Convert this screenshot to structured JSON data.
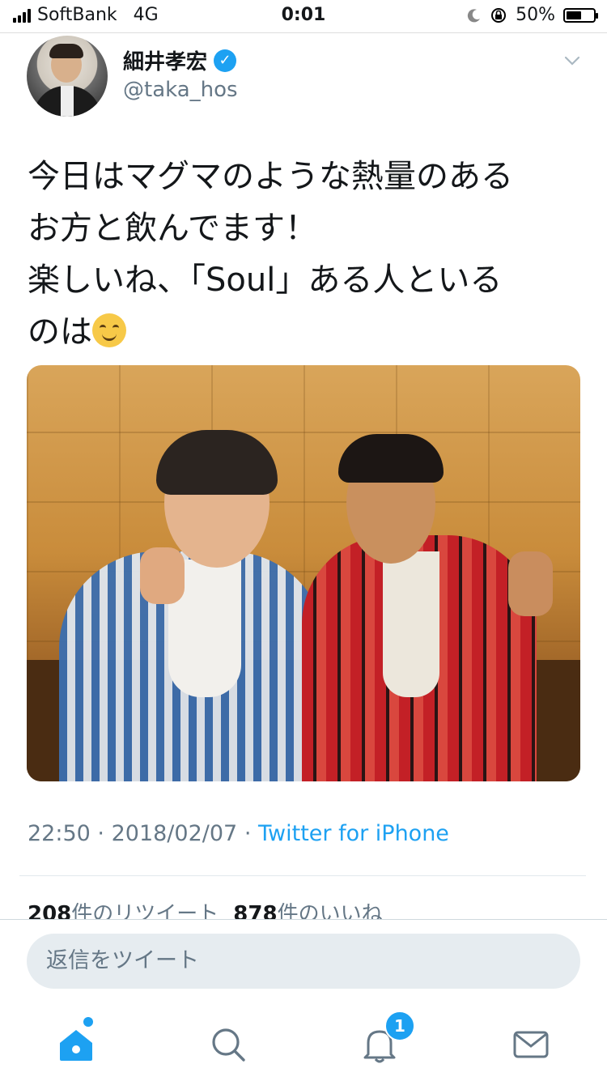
{
  "status_bar": {
    "carrier": "SoftBank",
    "network": "4G",
    "time": "0:01",
    "battery": "50%"
  },
  "tweet": {
    "author_name": "細井孝宏",
    "handle": "@taka_hos",
    "text": "今日はマグマのような熱量のある\nお方と飲んでます！\n楽しいね、「Soul」ある人といる\nのは",
    "emoji": "smiling-face-icon",
    "time": "22:50",
    "date": "2018/02/07",
    "separator": "·",
    "via": "Twitter for iPhone",
    "retweet_count": "208",
    "retweet_label": "件のリツイート",
    "like_count": "878",
    "like_label": "件のいいね"
  },
  "reply": {
    "placeholder": "返信をツイート"
  },
  "tab_bar": {
    "items": [
      {
        "name": "home-icon"
      },
      {
        "name": "search-icon"
      },
      {
        "name": "notifications-icon",
        "badge": "1"
      },
      {
        "name": "messages-icon"
      }
    ]
  },
  "colors": {
    "accent": "#1da1f2",
    "muted": "#657786",
    "text": "#14171a"
  }
}
